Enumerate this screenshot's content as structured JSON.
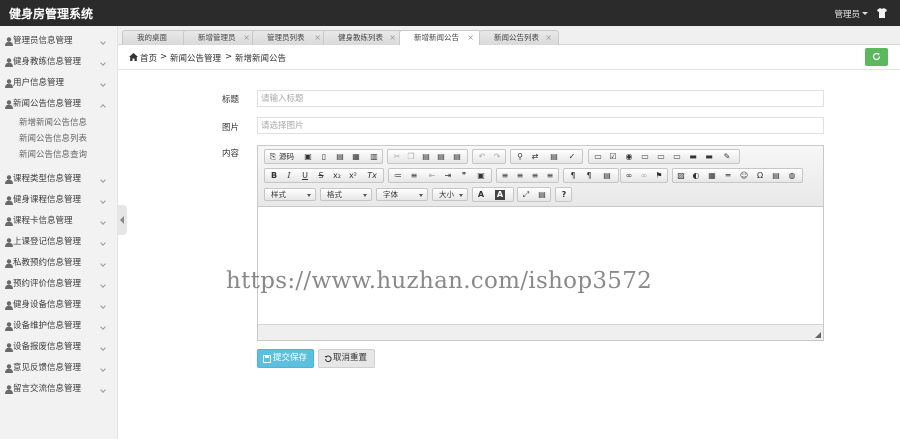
{
  "header": {
    "brand": "健身房管理系统",
    "user": "管理员"
  },
  "sidebar": {
    "items": [
      {
        "label": "管理员信息管理"
      },
      {
        "label": "健身教练信息管理"
      },
      {
        "label": "用户信息管理"
      },
      {
        "label": "新闻公告信息管理",
        "open": true,
        "subs": [
          "新增新闻公告信息",
          "新闻公告信息列表",
          "新闻公告信息查询"
        ]
      },
      {
        "label": "课程类型信息管理"
      },
      {
        "label": "健身课程信息管理"
      },
      {
        "label": "课程卡信息管理"
      },
      {
        "label": "上课登记信息管理"
      },
      {
        "label": "私教预约信息管理"
      },
      {
        "label": "预约评价信息管理"
      },
      {
        "label": "健身设备信息管理"
      },
      {
        "label": "设备维护信息管理"
      },
      {
        "label": "设备报废信息管理"
      },
      {
        "label": "意见反馈信息管理"
      },
      {
        "label": "留言交流信息管理"
      }
    ]
  },
  "tabs": [
    "我的桌面",
    "新增管理员",
    "管理员列表",
    "健身教练列表",
    "新增新闻公告",
    "新闻公告列表"
  ],
  "breadcrumb": {
    "home": "首页",
    "sep": ">",
    "level1": "新闻公告管理",
    "level2": "新增新闻公告"
  },
  "form": {
    "title_label": "标题",
    "title_placeholder": "请输入标题",
    "image_label": "图片",
    "image_placeholder": "请选择图片",
    "content_label": "内容"
  },
  "editor": {
    "source_label": "源码",
    "styles_label": "样式",
    "format_label": "格式",
    "font_label": "字体",
    "size_label": "大小",
    "help_label": "?"
  },
  "watermark": "https://www.huzhan.com/ishop3572",
  "buttons": {
    "submit": "提交保存",
    "reset": "取消重置"
  },
  "colors": {
    "topbar": "#2b2b2b",
    "submit": "#5bc0de",
    "refresh": "#5cb85c"
  }
}
